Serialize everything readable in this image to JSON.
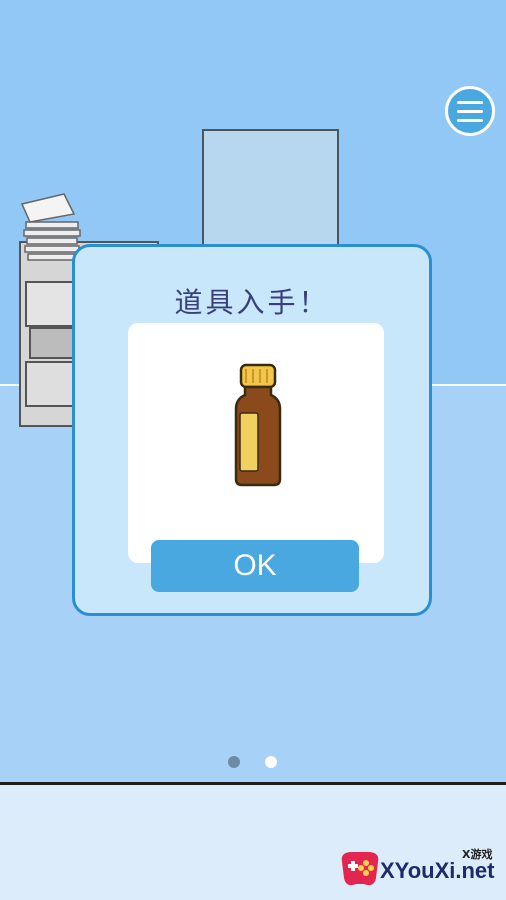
{
  "scene": {
    "menu_button_icon": "hamburger-menu-icon",
    "page_indicator": {
      "count": 2,
      "active_index": 1
    }
  },
  "dialog": {
    "title": "道具入手！",
    "item_icon": "medicine-bottle-icon",
    "ok_label": "OK"
  },
  "watermark": {
    "small_text": "X游戏",
    "brand_text": "XYouXi.net"
  },
  "colors": {
    "accent_blue": "#4aa8e0",
    "dialog_border": "#2a8ed3",
    "dialog_bg": "#c9e7fb",
    "wall": "#92c8f5",
    "floor": "#a7d1f6",
    "title_text": "#3a3f7c"
  }
}
